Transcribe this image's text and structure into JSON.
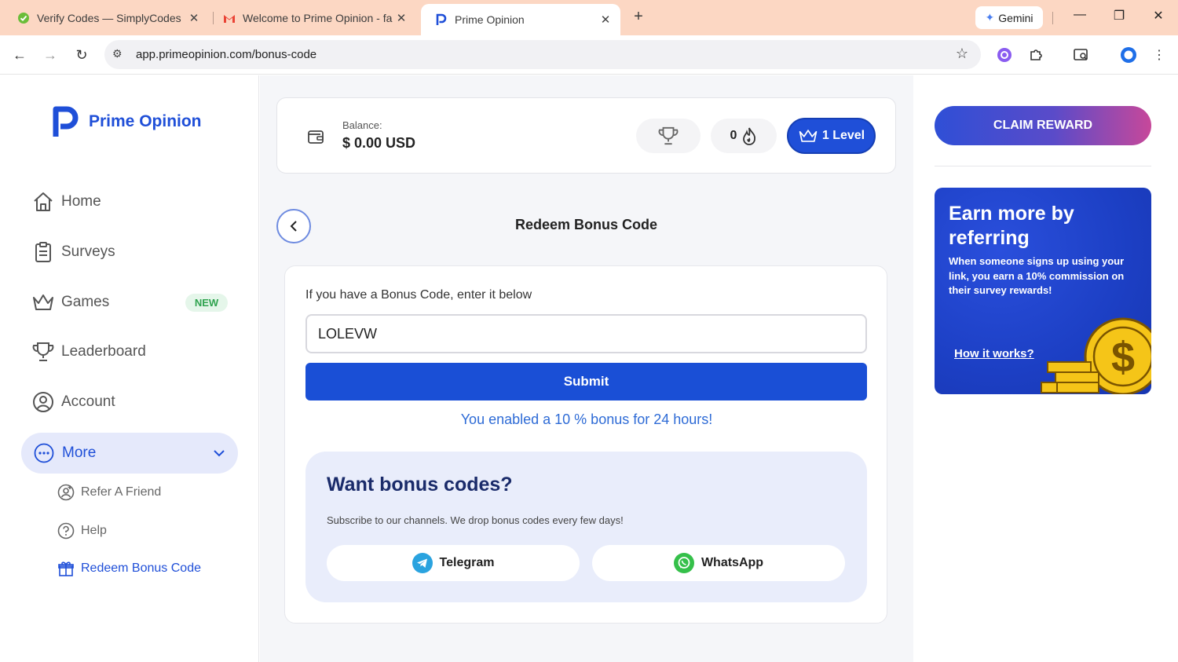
{
  "browser": {
    "tabs": [
      {
        "label": "Verify Codes — SimplyCodes",
        "icon": "simplycodes-icon"
      },
      {
        "label": "Welcome to Prime Opinion - fa",
        "icon": "gmail-icon"
      },
      {
        "label": "Prime Opinion",
        "icon": "prime-opinion-icon",
        "active": true
      }
    ],
    "gemini_label": "Gemini",
    "url": "app.primeopinion.com/bonus-code"
  },
  "sidebar": {
    "brand": "Prime Opinion",
    "items": [
      {
        "label": "Home",
        "icon": "home-icon"
      },
      {
        "label": "Surveys",
        "icon": "clipboard-icon"
      },
      {
        "label": "Games",
        "icon": "crown-icon",
        "badge": "NEW"
      },
      {
        "label": "Leaderboard",
        "icon": "trophy-icon"
      },
      {
        "label": "Account",
        "icon": "user-circle-icon"
      }
    ],
    "more_label": "More",
    "sub_items": [
      {
        "label": "Refer A Friend",
        "icon": "refer-icon"
      },
      {
        "label": "Help",
        "icon": "help-icon"
      },
      {
        "label": "Redeem Bonus Code",
        "icon": "gift-icon",
        "active": true
      }
    ]
  },
  "header": {
    "balance_label": "Balance:",
    "balance_value": "$ 0.00 USD",
    "streak_count": "0",
    "level_label": "1 Level"
  },
  "page": {
    "title": "Redeem Bonus Code",
    "form_hint": "If you have a Bonus Code, enter it below",
    "code_value": "LOLEVW",
    "submit_label": "Submit",
    "success_message": "You enabled a 10 % bonus for 24 hours!",
    "promo": {
      "title": "Want bonus codes?",
      "subtitle": "Subscribe to our channels. We drop bonus codes every few days!",
      "telegram_label": "Telegram",
      "whatsapp_label": "WhatsApp"
    }
  },
  "right": {
    "claim_label": "CLAIM REWARD",
    "refer_title": "Earn more by referring",
    "refer_text": "When someone signs up using your link, you earn a 10% commission on their survey rewards!",
    "refer_link": "How it works?"
  },
  "colors": {
    "brand_blue": "#1f4fd8",
    "tabstrip": "#fcd7c3",
    "success_text": "#2e6bd6",
    "new_badge": "#2fa34f"
  }
}
